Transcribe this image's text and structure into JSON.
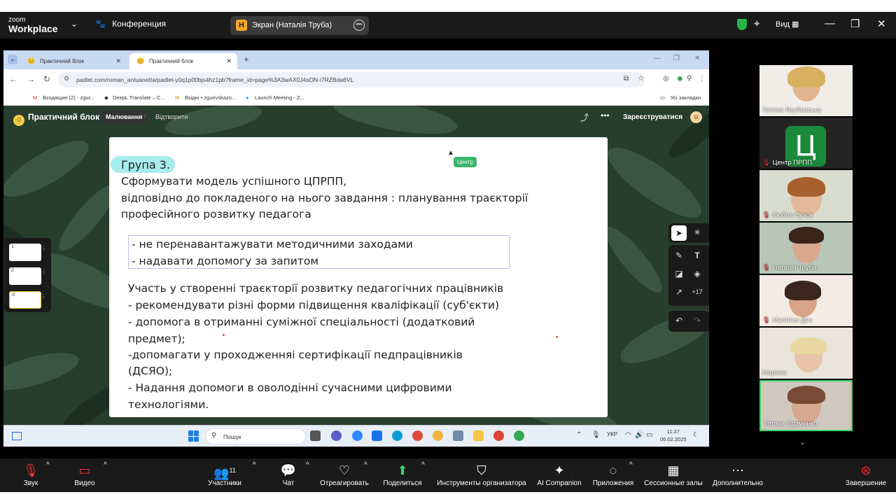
{
  "zoom": {
    "logo_line1": "zoom",
    "logo_line2": "Workplace",
    "conference_label": "Конференция",
    "screen_share_label": "Экран (Наталія Труба)",
    "screen_badge": "Н",
    "view_label": "Вид",
    "bottom": {
      "audio": "Звук",
      "video": "Видео",
      "participants": "Участники",
      "participants_count": "11",
      "chat": "Чат",
      "react": "Отреагировать",
      "share": "Поделиться",
      "host_tools": "Инструменты организатора",
      "ai": "AI Companion",
      "apps": "Приложения",
      "breakout": "Сессионные залы",
      "more": "Дополнительно",
      "end": "Завершение"
    }
  },
  "browser": {
    "tabs": [
      {
        "label": "Практичний блок"
      },
      {
        "label": "Практичний блок"
      }
    ],
    "url": "padlet.com/roman_antuanetta/padlet-y0q1p00bjs4hz1pb?frame_id=page%3A3wAX0J4sON-i7RZBda6VL",
    "bookmarks": [
      "Входящие (2) - zgur...",
      "DeepL Translate – С...",
      "Вхідні • zgurivskazo...",
      "Launch Meeting - Z..."
    ],
    "all_bookmarks": "Усі закладки"
  },
  "padlet": {
    "title": "Практичний блок",
    "mode": "Малювання",
    "open": "Відтворити",
    "register": "Зареєструватися",
    "center_tag": "Центр",
    "slide_thumbs": [
      "1",
      "2",
      "3"
    ],
    "tools_more": "+17"
  },
  "slide": {
    "group": "Група 3.",
    "lines": [
      "Сформувати модель успішного ЦПРПП,",
      "відповідно до покладеного на нього завдання : планування траєкторії",
      "професійного розвитку педагога"
    ],
    "box": [
      "- не перенавантажувати методичними заходами",
      "- надавати допомогу за запитом"
    ],
    "participation": [
      "Участь у створенні траєкторії розвитку педагогічних працівників",
      "- рекомендувати різні форми підвищення кваліфікації (суб'єкти)",
      "- допомога в отриманні суміжної спеціальності (додатковий",
      "предмет);",
      "-допомагати у проходженняі сертифікації педпрацівників",
      "(ДСЯО);",
      "- Надання допомоги в оволодінні сучасними цифровими",
      "технологіями."
    ]
  },
  "taskbar": {
    "search": "Пошук",
    "lang": "УКР",
    "time": "11:27",
    "date": "06.02.2025"
  },
  "participants": [
    {
      "name": "Тетяна Якубовська",
      "muted": false
    },
    {
      "name": "Центр ПРПП",
      "muted": true,
      "initial": "Ц"
    },
    {
      "name": "Любов Сучок",
      "muted": true
    },
    {
      "name": "Наталія Труба",
      "muted": true
    },
    {
      "name": "Малятко Днз",
      "muted": true
    },
    {
      "name": "Марина",
      "muted": false
    },
    {
      "name": "Тетяна Єфіменко",
      "muted": false
    }
  ]
}
